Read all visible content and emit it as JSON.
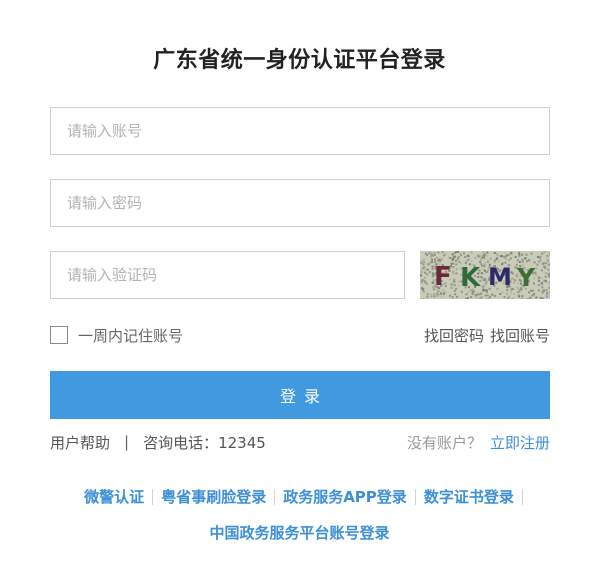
{
  "title": "广东省统一身份认证平台登录",
  "form": {
    "username_placeholder": "请输入账号",
    "password_placeholder": "请输入密码",
    "code_placeholder": "请输入验证码",
    "captcha_text": "FKMY"
  },
  "remember_label": "一周内记住账号",
  "recover": {
    "password": "找回密码",
    "account": "找回账号"
  },
  "login_button": "登录",
  "help": {
    "label": "用户帮助",
    "separator": "|",
    "hotline": "咨询电话：12345"
  },
  "register": {
    "question": "没有账户？",
    "link": "立即注册"
  },
  "alt_logins": [
    "微警认证",
    "粤省事刷脸登录",
    "政务服务APP登录",
    "数字证书登录"
  ],
  "alt_login_national": "中国政务服务平台账号登录",
  "colors": {
    "primary": "#4199e0",
    "link": "#3d8fd6"
  }
}
